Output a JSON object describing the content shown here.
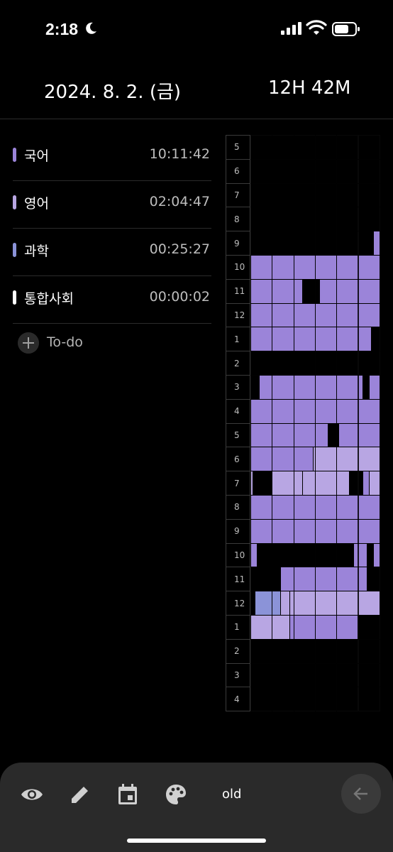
{
  "status_bar": {
    "time": "2:18"
  },
  "header": {
    "date": "2024. 8. 2. (금)",
    "total": "12H 42M"
  },
  "subjects": [
    {
      "name": "국어",
      "time": "10:11:42",
      "color": "#9b84d9"
    },
    {
      "name": "영어",
      "time": "02:04:47",
      "color": "#b8a6e3"
    },
    {
      "name": "과학",
      "time": "00:25:27",
      "color": "#8b93d8"
    },
    {
      "name": "통합사회",
      "time": "00:00:02",
      "color": "#ffffff"
    }
  ],
  "todo": {
    "label": "To-do"
  },
  "timetable": {
    "hours": [
      "5",
      "6",
      "7",
      "8",
      "9",
      "10",
      "11",
      "12",
      "1",
      "2",
      "3",
      "4",
      "5",
      "6",
      "7",
      "8",
      "9",
      "10",
      "11",
      "12",
      "1",
      "2",
      "3",
      "4"
    ]
  },
  "toolbar": {
    "label": "old"
  },
  "colors": {
    "korean": "#9b84d9",
    "english": "#b8a6e3",
    "science": "#8b93d8",
    "grid": "#3a3a3a",
    "background": "#000000",
    "toolbar": "#2a2a2a"
  }
}
